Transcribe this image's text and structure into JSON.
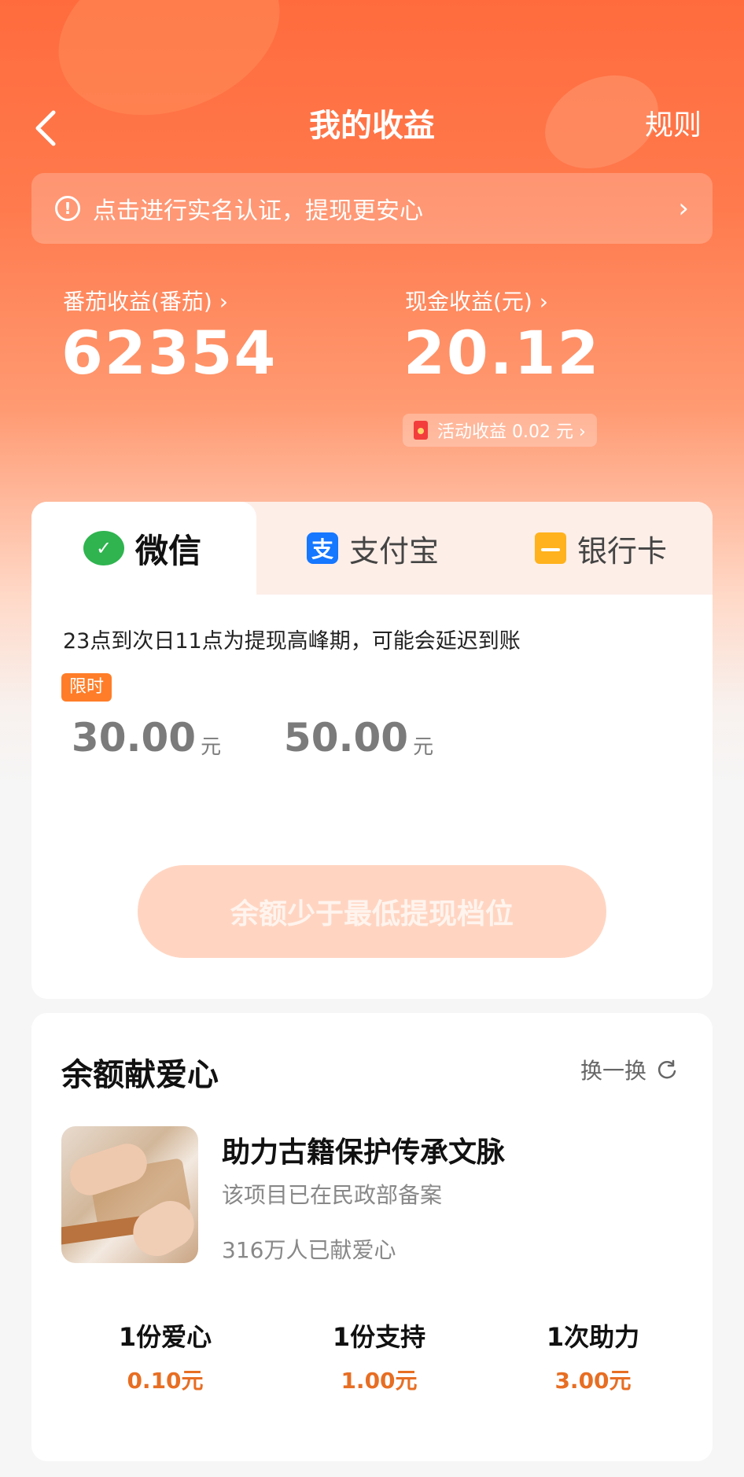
{
  "header": {
    "title": "我的收益",
    "rules_label": "规则"
  },
  "verify_banner": {
    "text": "点击进行实名认证，提现更安心",
    "info_glyph": "!",
    "chevron": "›"
  },
  "earnings": {
    "tomato_label": "番茄收益(番茄) ›",
    "tomato_value": "62354",
    "cash_label": "现金收益(元) ›",
    "cash_value": "20.12",
    "activity_text": "活动收益 0.02 元 ›"
  },
  "withdraw": {
    "tabs": [
      {
        "label": "微信",
        "icon": "wechat-icon",
        "selected": true
      },
      {
        "label": "支付宝",
        "icon": "alipay-icon",
        "selected": false
      },
      {
        "label": "银行卡",
        "icon": "bank-card-icon",
        "selected": false
      }
    ],
    "alipay_glyph": "支",
    "peak_note": "23点到次日11点为提现高峰期，可能会延迟到账",
    "limited_badge": "限时",
    "amounts": [
      {
        "value": "30.00",
        "unit": "元"
      },
      {
        "value": "50.00",
        "unit": "元"
      }
    ],
    "button_label": "余额少于最低提现档位"
  },
  "charity": {
    "title": "余额献爱心",
    "refresh_label": "换一换",
    "project_name": "助力古籍保护传承文脉",
    "project_registered": "该项目已在民政部备案",
    "project_donors": "316万人已献爱心",
    "options": [
      {
        "name": "1份爱心",
        "price": "0.10元"
      },
      {
        "name": "1份支持",
        "price": "1.00元"
      },
      {
        "name": "1次助力",
        "price": "3.00元"
      }
    ]
  },
  "colors": {
    "brand_orange": "#ff6b3d",
    "wechat_green": "#2fb44f",
    "alipay_blue": "#1677ff",
    "bank_yellow": "#ffb21d",
    "price_orange": "#e76e23"
  }
}
